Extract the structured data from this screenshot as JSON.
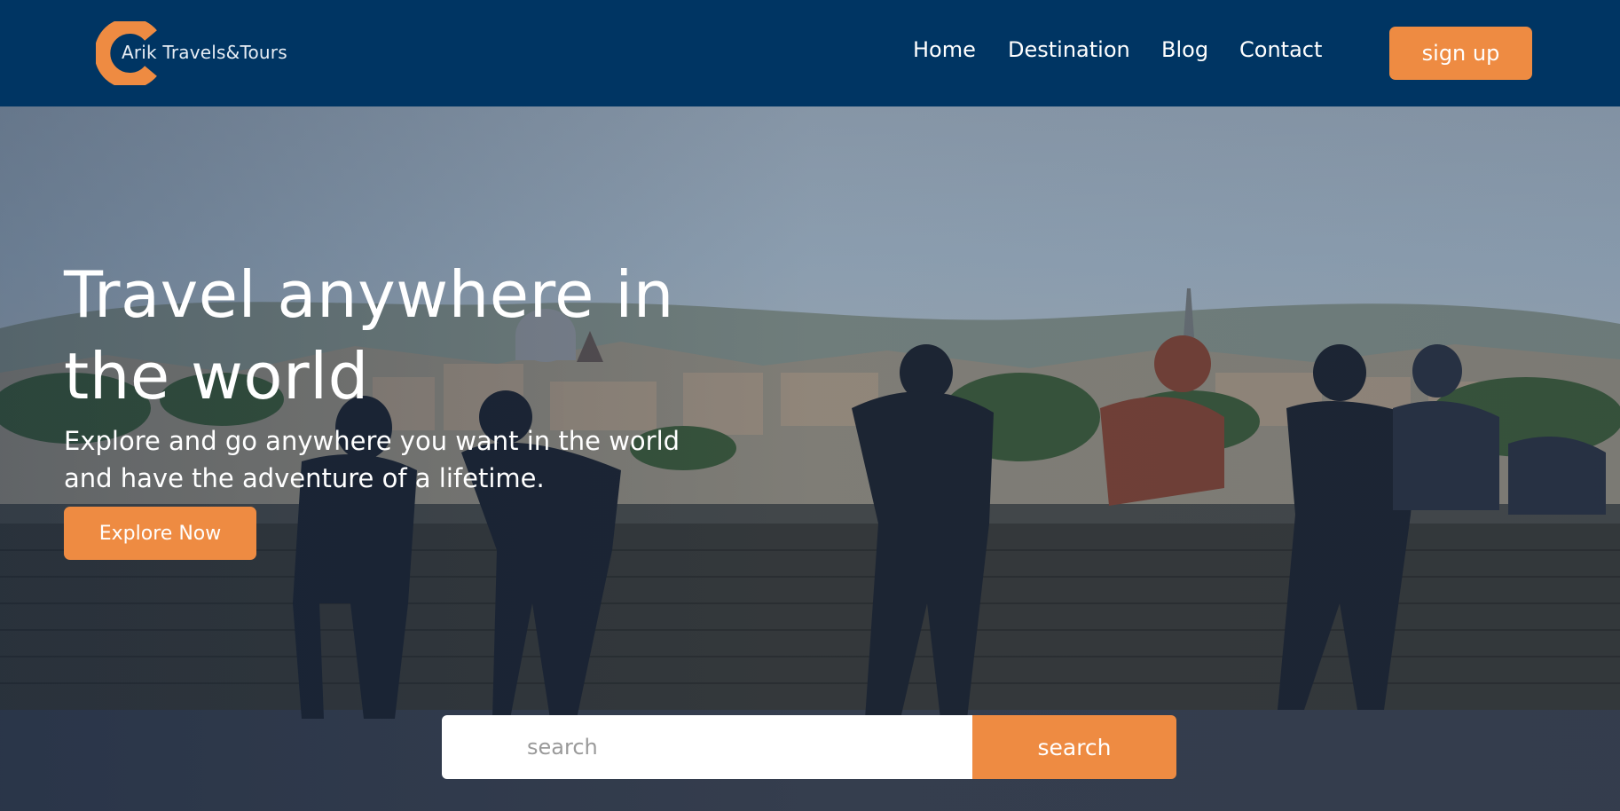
{
  "brand": {
    "name": "Arik Travels&Tours",
    "accent_color": "#ee8b42",
    "nav_bg_color": "#003563"
  },
  "nav": {
    "links": [
      {
        "label": "Home"
      },
      {
        "label": "Destination"
      },
      {
        "label": "Blog"
      },
      {
        "label": "Contact"
      }
    ],
    "signup_label": "sign up"
  },
  "hero": {
    "title_line1": "Travel anywhere in",
    "title_line2": "the world",
    "subtitle_line1": "Explore and go anywhere you want in the world",
    "subtitle_line2": "and have the adventure of a lifetime.",
    "cta_label": "Explore Now"
  },
  "search": {
    "placeholder": "search",
    "value": "",
    "button_label": "search"
  },
  "icons": {
    "logo": "logo-c-mark-icon"
  }
}
